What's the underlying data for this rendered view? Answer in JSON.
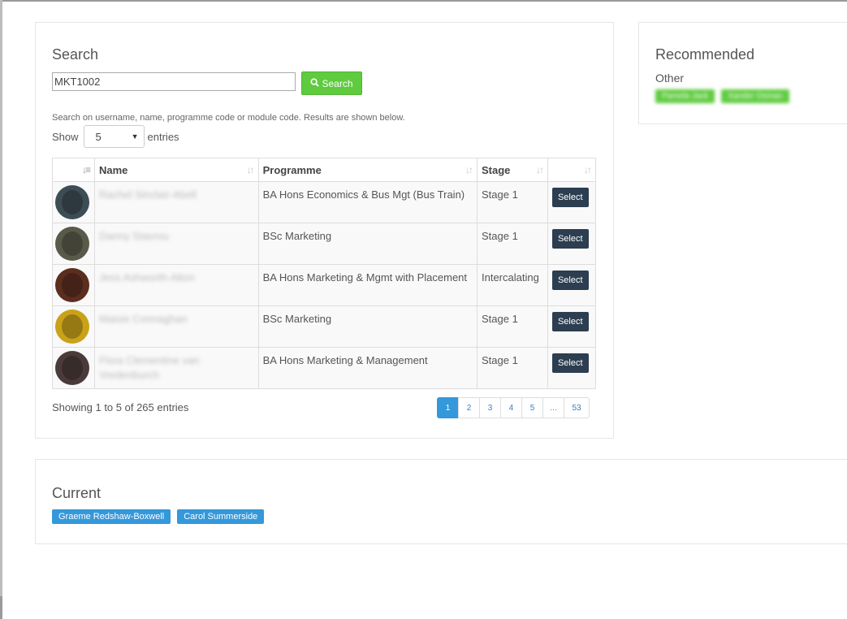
{
  "search": {
    "title": "Search",
    "input_value": "MKT1002",
    "button_label": "Search",
    "hint": "Search on username, name, programme code or module code. Results are shown below.",
    "show_label": "Show",
    "entries_value": "5",
    "entries_label": "entries"
  },
  "table": {
    "headers": [
      "",
      "Name",
      "Programme",
      "Stage",
      ""
    ],
    "rows": [
      {
        "name": "Rachel Sinclair-Abell",
        "programme": "BA Hons Economics & Bus Mgt (Bus Train)",
        "stage": "Stage 1",
        "action": "Select",
        "avatar_color": "#3d4d55"
      },
      {
        "name": "Danny Stavrou",
        "programme": "BSc Marketing",
        "stage": "Stage 1",
        "action": "Select",
        "avatar_color": "#5a5a4a"
      },
      {
        "name": "Jess Ashworth-Alton",
        "programme": "BA Hons Marketing & Mgmt with Placement",
        "stage": "Intercalating",
        "action": "Select",
        "avatar_color": "#5b2e1f"
      },
      {
        "name": "Maisie Connaghan",
        "programme": "BSc Marketing",
        "stage": "Stage 1",
        "action": "Select",
        "avatar_color": "#c9a21a"
      },
      {
        "name": "Flora Clementine van Vredenburch",
        "programme": "BA Hons Marketing & Management",
        "stage": "Stage 1",
        "action": "Select",
        "avatar_color": "#4a3b3a"
      }
    ],
    "showing": "Showing 1 to 5 of 265 entries"
  },
  "pagination": [
    "1",
    "2",
    "3",
    "4",
    "5",
    "…",
    "53"
  ],
  "recommended": {
    "title": "Recommended",
    "other_label": "Other",
    "tags": [
      "Pamela Jack",
      "Xander Osman"
    ]
  },
  "current": {
    "title": "Current",
    "tags": [
      "Graeme Redshaw-Boxwell",
      "Carol Summerside"
    ]
  },
  "colors": {
    "search_button": "#5fcb3f",
    "select_button": "#2c3e50",
    "current_tag": "#3498db",
    "active_page": "#3498db"
  }
}
